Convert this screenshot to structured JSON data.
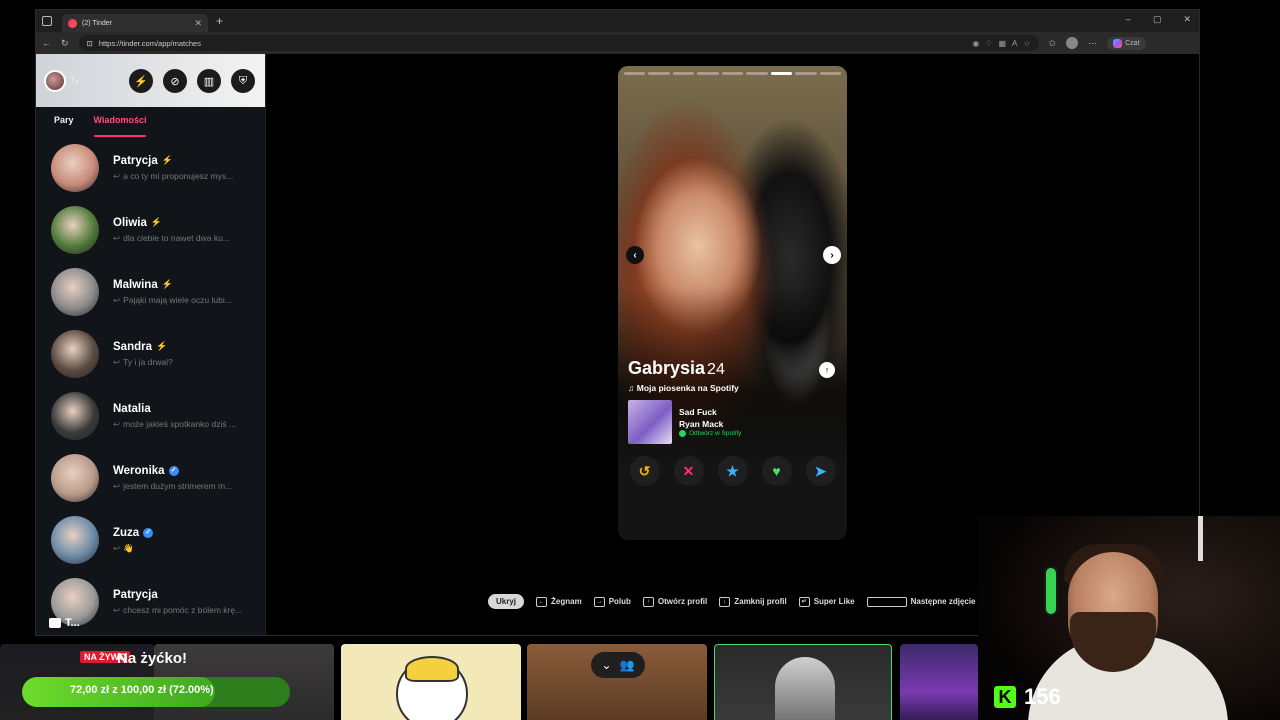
{
  "browser": {
    "tab_title": "(2) Tinder",
    "new_tab": "+",
    "url": "https://tinder.com/app/matches",
    "copilot_label": "Czat",
    "window_controls": [
      "–",
      "▢",
      "✕"
    ]
  },
  "sidebar": {
    "me_label": "Ty",
    "tabs": [
      "Pary",
      "Wiadomości"
    ],
    "active_tab": "Wiadomości",
    "conversations": [
      {
        "name": "Patrycja",
        "badge": "boost",
        "preview": "a co ty mi proponujesz mys...",
        "avatar_color": "#c98a7a"
      },
      {
        "name": "Oliwia",
        "badge": "boost",
        "preview": "dla ciebie to nawet dwa ku...",
        "avatar_color": "#4f7a3a"
      },
      {
        "name": "Malwina",
        "badge": "boost",
        "preview": "Pająki mają wiele oczu lubi...",
        "avatar_color": "#8a8a8a"
      },
      {
        "name": "Sandra",
        "badge": "boost",
        "preview": "Ty i ja drwal?",
        "avatar_color": "#5a4a40"
      },
      {
        "name": "Natalia",
        "badge": "",
        "preview": "może jakieś spotkanko dziś ...",
        "avatar_color": "#3a3a3a"
      },
      {
        "name": "Weronika",
        "badge": "verified",
        "preview": "jestem dużym strimerem m...",
        "avatar_color": "#b89a8a"
      },
      {
        "name": "Zuza",
        "badge": "verified",
        "preview": "👋",
        "avatar_color": "#6a8aa8"
      },
      {
        "name": "Patrycja",
        "badge": "",
        "preview": "chcesz mi pomóc z bólem krę...",
        "avatar_color": "#9a9a9a"
      }
    ],
    "chat_pill": "T..."
  },
  "profile": {
    "name": "Gabrysia",
    "age": "24",
    "photo_count": 9,
    "active_photo": 6,
    "spotify_heading": "Moja piosenka na Spotify",
    "song_title": "Sad Fuck",
    "song_artist": "Ryan Mack",
    "spotify_link": "Odtwórz w Spotify"
  },
  "actions": {
    "rewind": "↺",
    "nope": "✕",
    "super_like": "★",
    "like": "♥",
    "boost": "➤"
  },
  "shortcuts": {
    "hide": "Ukryj",
    "items": [
      "Żegnam",
      "Polub",
      "Otwórz profil",
      "Zamknij profil",
      "Super Like",
      "Następne zdjęcie"
    ]
  },
  "stream": {
    "live_tag": "NA ŻYWO",
    "live_title": "Na żyćko!",
    "goal_text": "72,00 zł z 100,00 zł (72.00%)",
    "goal_progress": 0.72,
    "viewer_count": "156",
    "kick_logo": "K"
  },
  "colors": {
    "tinder_accent": "#ff2d6f",
    "boost_purple": "#a45cff",
    "verified_blue": "#3a8cff",
    "spotify_green": "#1ed760",
    "kick_green": "#53fc18"
  }
}
